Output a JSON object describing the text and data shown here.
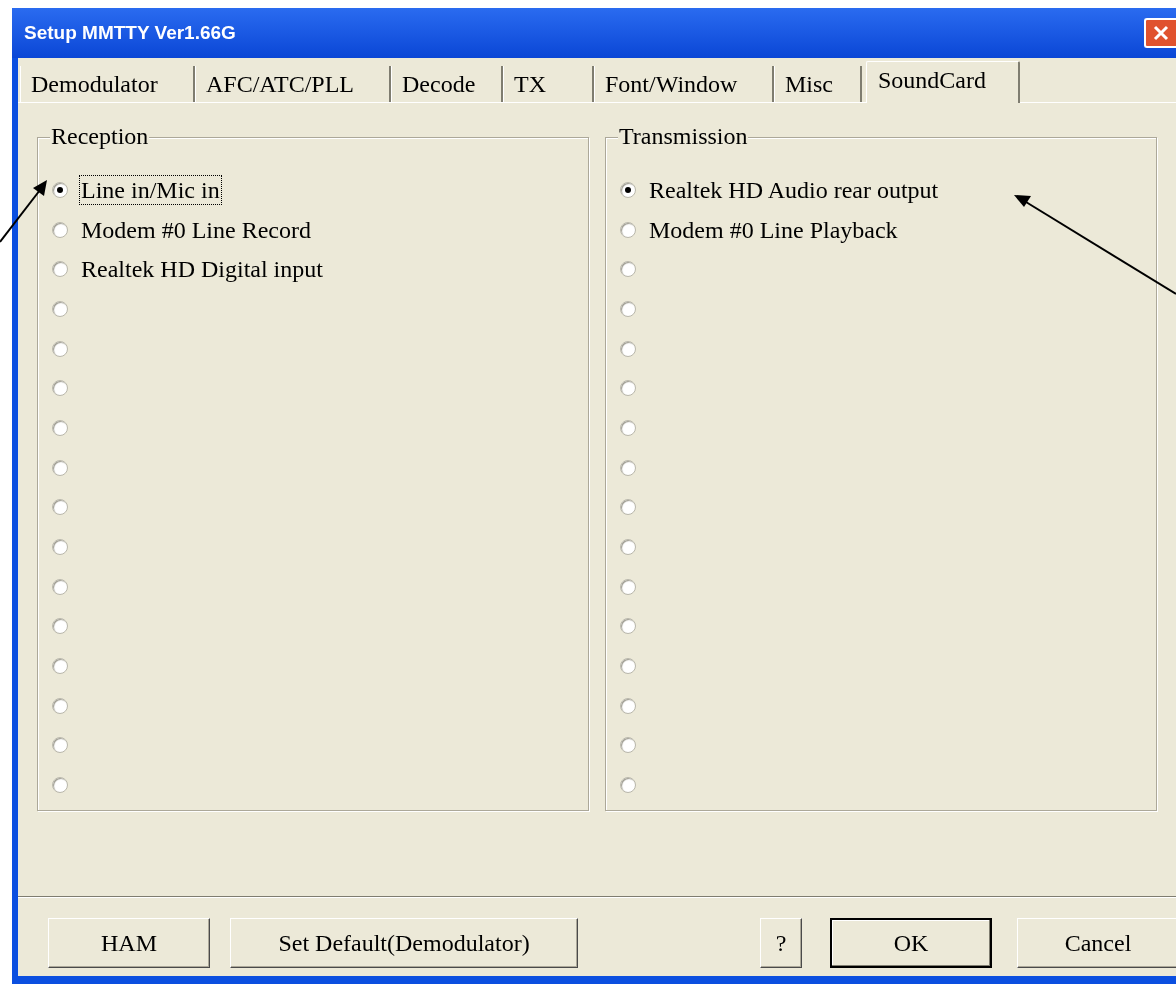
{
  "window": {
    "title": "Setup MMTTY Ver1.66G"
  },
  "tabs": [
    {
      "label": "Demodulator",
      "selected": false
    },
    {
      "label": "AFC/ATC/PLL",
      "selected": false
    },
    {
      "label": "Decode",
      "selected": false
    },
    {
      "label": "TX",
      "selected": false
    },
    {
      "label": "Font/Window",
      "selected": false
    },
    {
      "label": "Misc",
      "selected": false
    },
    {
      "label": "SoundCard",
      "selected": true
    }
  ],
  "groups": [
    {
      "title": "Reception",
      "options": [
        {
          "label": "Line in/Mic in",
          "selected": true,
          "focused": true
        },
        {
          "label": "Modem #0 Line Record",
          "selected": false
        },
        {
          "label": "Realtek HD Digital input",
          "selected": false
        },
        {
          "selected": false
        },
        {
          "selected": false
        },
        {
          "selected": false
        },
        {
          "selected": false
        },
        {
          "selected": false
        },
        {
          "selected": false
        },
        {
          "selected": false
        },
        {
          "selected": false
        },
        {
          "selected": false
        },
        {
          "selected": false
        },
        {
          "selected": false
        },
        {
          "selected": false
        },
        {
          "selected": false
        }
      ]
    },
    {
      "title": "Transmission",
      "options": [
        {
          "label": "Realtek HD Audio rear output",
          "selected": true
        },
        {
          "label": "Modem #0 Line Playback",
          "selected": false
        },
        {
          "selected": false
        },
        {
          "selected": false
        },
        {
          "selected": false
        },
        {
          "selected": false
        },
        {
          "selected": false
        },
        {
          "selected": false
        },
        {
          "selected": false
        },
        {
          "selected": false
        },
        {
          "selected": false
        },
        {
          "selected": false
        },
        {
          "selected": false
        },
        {
          "selected": false
        },
        {
          "selected": false
        },
        {
          "selected": false
        }
      ]
    }
  ],
  "buttons": [
    {
      "label": "HAM",
      "default": false
    },
    {
      "label": "Set Default(Demodulator)",
      "default": false
    },
    {
      "label": "?",
      "default": false
    },
    {
      "label": "OK",
      "default": true
    },
    {
      "label": "Cancel",
      "default": false
    }
  ]
}
